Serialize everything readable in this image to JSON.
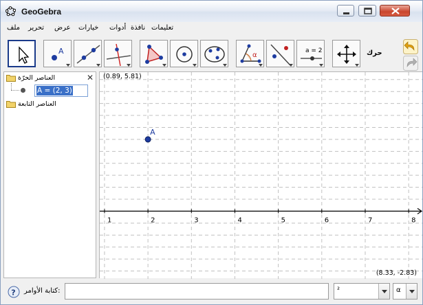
{
  "window": {
    "title": "GeoGebra"
  },
  "menu": {
    "items": [
      "ملف",
      "تحرير",
      "عرض",
      "خيارات",
      "أدوات",
      "نافذة",
      "تعليمات"
    ]
  },
  "toolbar": {
    "tools": [
      {
        "name": "move",
        "icon": "move-arrow-icon",
        "selected": true
      },
      {
        "name": "new-point",
        "icon": "point-icon"
      },
      {
        "name": "line-through-two-points",
        "icon": "line-icon"
      },
      {
        "name": "perpendicular-line",
        "icon": "perpendicular-icon"
      },
      {
        "name": "polygon",
        "icon": "polygon-icon"
      },
      {
        "name": "circle-center-point",
        "icon": "circle-icon"
      },
      {
        "name": "conic-five-points",
        "icon": "conic-icon"
      },
      {
        "name": "angle",
        "icon": "angle-icon"
      },
      {
        "name": "reflect-about-line",
        "icon": "reflect-icon"
      },
      {
        "name": "slider",
        "icon": "slider-icon",
        "label": "a = 2"
      },
      {
        "name": "move-graphics-view",
        "icon": "move-view-icon"
      }
    ],
    "help_text": "حرك"
  },
  "algebra": {
    "free_objects_label": "العناصر الحرّة",
    "dependent_objects_label": "العناصر التابعة",
    "selected_object": "A = (2, 3)"
  },
  "graphics": {
    "corner_top_left": "(0.89, 5.81)",
    "corner_bottom_right": "(8.33, -2.83)",
    "x_ticks": [
      "1",
      "2",
      "3",
      "4",
      "5",
      "6",
      "7",
      "8"
    ],
    "point": {
      "label": "A",
      "x": 2,
      "y": 3
    },
    "colors": {
      "grid": "#c0c0c0",
      "point": "#1e3ca0"
    }
  },
  "inputbar": {
    "label": "كتابة الأوامر:",
    "value": "",
    "combo_symbol": "²",
    "combo_greek": "α"
  }
}
